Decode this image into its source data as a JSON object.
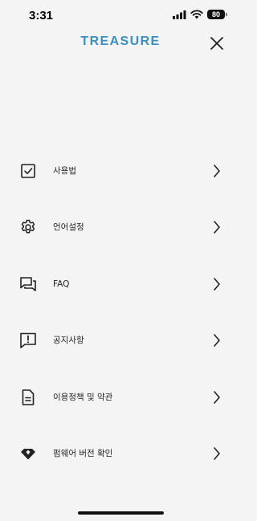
{
  "status_bar": {
    "time": "3:31",
    "battery": "80"
  },
  "header": {
    "logo": "TREASURE",
    "brand_color": "#3a8fbf"
  },
  "menu": {
    "items": [
      {
        "label": "사용법",
        "icon": "checkbox-icon"
      },
      {
        "label": "언어설정",
        "icon": "gear-icon"
      },
      {
        "label": "FAQ",
        "icon": "chat-bubbles-icon"
      },
      {
        "label": "공지사항",
        "icon": "alert-message-icon"
      },
      {
        "label": "이용정책 및 약관",
        "icon": "document-icon"
      },
      {
        "label": "펌웨어 버전 확인",
        "icon": "diamond-icon"
      }
    ]
  }
}
